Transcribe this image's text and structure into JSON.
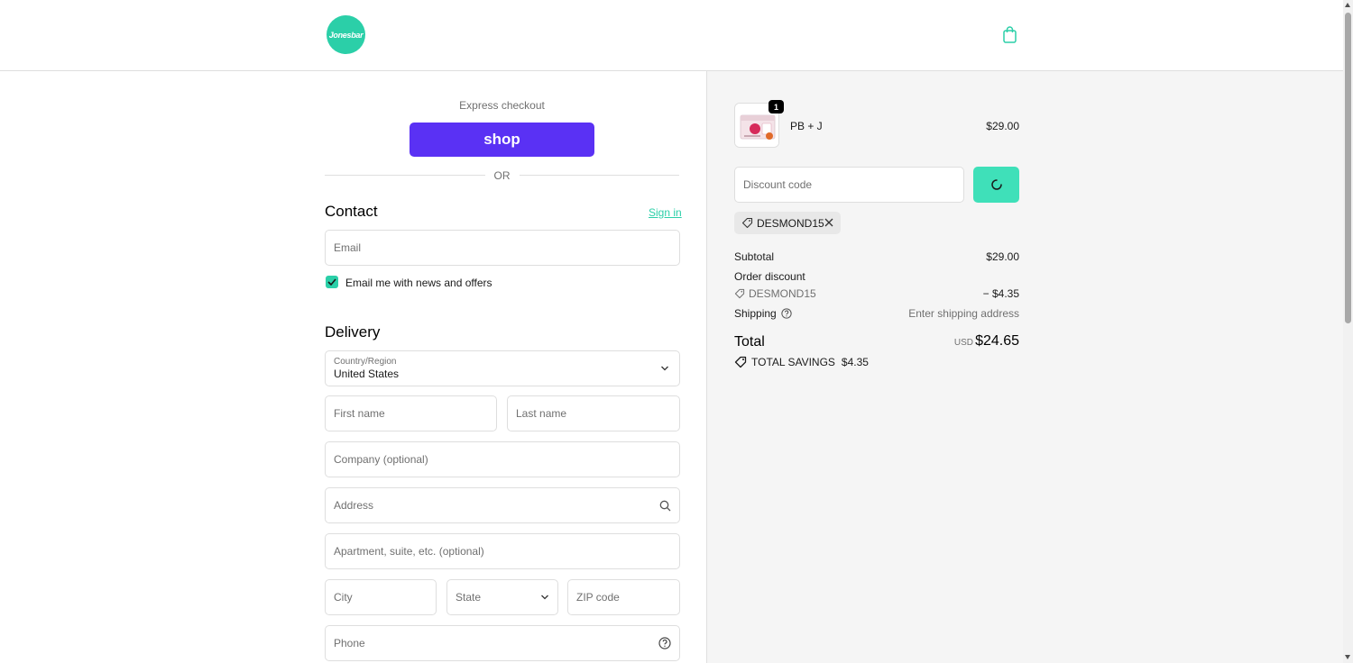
{
  "header": {
    "logo_text": "Jonesbar",
    "bag_icon": "shopping-bag-icon"
  },
  "express": {
    "label": "Express checkout",
    "shop_label": "shop",
    "or_label": "OR"
  },
  "contact": {
    "title": "Contact",
    "signin_label": "Sign in",
    "email_placeholder": "Email",
    "newsletter_label": "Email me with news and offers",
    "newsletter_checked": true
  },
  "delivery": {
    "title": "Delivery",
    "country_label": "Country/Region",
    "country_value": "United States",
    "first_name_placeholder": "First name",
    "last_name_placeholder": "Last name",
    "company_placeholder": "Company (optional)",
    "address_placeholder": "Address",
    "apartment_placeholder": "Apartment, suite, etc. (optional)",
    "city_placeholder": "City",
    "state_placeholder": "State",
    "zip_placeholder": "ZIP code",
    "phone_placeholder": "Phone"
  },
  "summary": {
    "item": {
      "quantity": "1",
      "name": "PB + J",
      "price": "$29.00"
    },
    "discount_placeholder": "Discount code",
    "applied_code": "DESMOND15",
    "subtotal_label": "Subtotal",
    "subtotal_value": "$29.00",
    "order_discount_label": "Order discount",
    "discount_code": "DESMOND15",
    "discount_value": "− $4.35",
    "shipping_label": "Shipping",
    "shipping_value": "Enter shipping address",
    "total_label": "Total",
    "currency": "USD",
    "total_value": "$24.65",
    "savings_label": "TOTAL SAVINGS",
    "savings_value": "$4.35"
  },
  "colors": {
    "accent": "#2bcfa8",
    "shop_purple": "#5a31f4",
    "apply_button": "#3fe0b9"
  }
}
